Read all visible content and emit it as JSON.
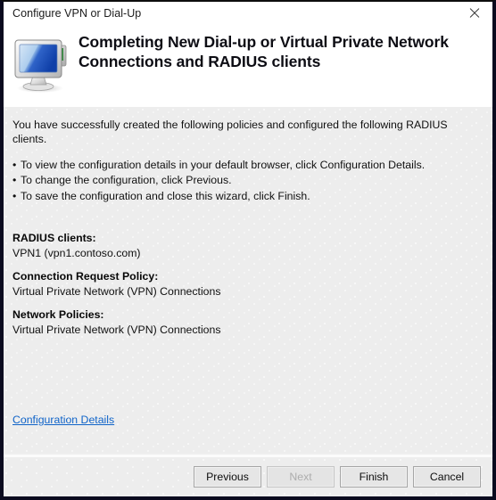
{
  "window": {
    "title": "Configure VPN or Dial-Up",
    "close_icon": "close-icon"
  },
  "header": {
    "icon": "monitor-network-icon",
    "title": "Completing New Dial-up or Virtual Private Network Connections and RADIUS clients"
  },
  "body": {
    "intro": "You have successfully created the following policies and configured the following RADIUS clients.",
    "bullet_marker": "•",
    "bullets": [
      "To view the configuration details in your default browser, click Configuration Details.",
      "To change the configuration, click Previous.",
      "To save the configuration and close this wizard, click Finish."
    ],
    "summary": [
      {
        "label": "RADIUS clients:",
        "value": "VPN1 (vpn1.contoso.com)"
      },
      {
        "label": "Connection Request Policy:",
        "value": "Virtual Private Network (VPN) Connections"
      },
      {
        "label": "Network Policies:",
        "value": "Virtual Private Network (VPN) Connections"
      }
    ],
    "config_details_link": "Configuration Details"
  },
  "footer": {
    "buttons": [
      {
        "label": "Previous",
        "disabled": false
      },
      {
        "label": "Next",
        "disabled": true
      },
      {
        "label": "Finish",
        "disabled": false
      },
      {
        "label": "Cancel",
        "disabled": false
      }
    ]
  },
  "colors": {
    "link": "#0f63c8",
    "body_background": "#ededed",
    "header_background": "#ffffff",
    "window_border": "#0a0a1e",
    "text": "#101010"
  }
}
